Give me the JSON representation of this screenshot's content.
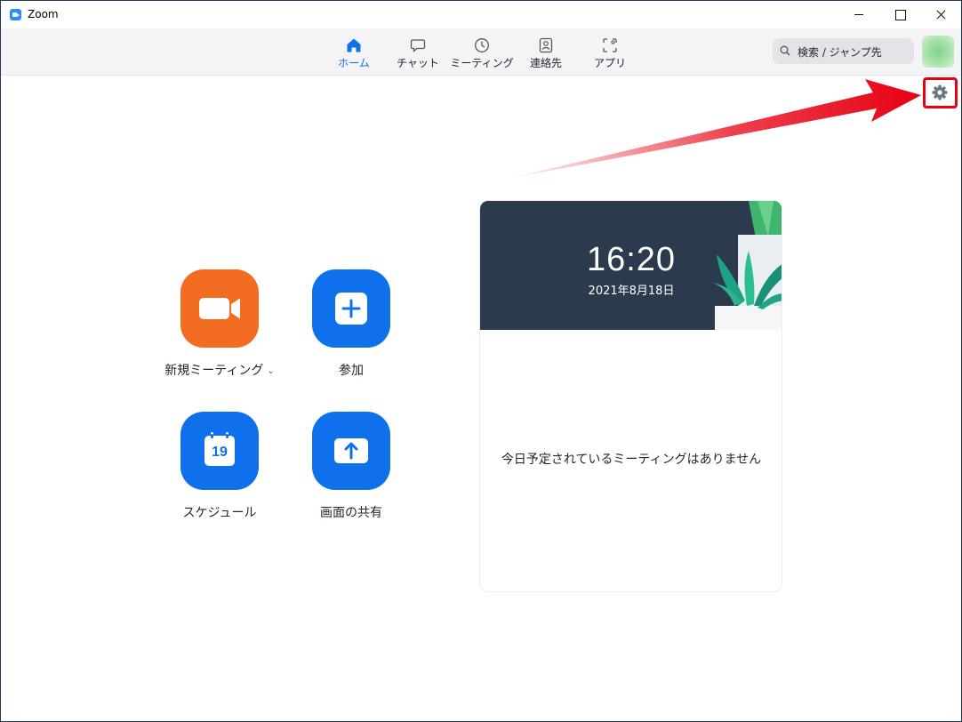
{
  "window": {
    "title": "Zoom"
  },
  "nav": {
    "tabs": [
      {
        "label": "ホーム",
        "icon": "home-icon",
        "active": true
      },
      {
        "label": "チャット",
        "icon": "chat-icon",
        "active": false
      },
      {
        "label": "ミーティング",
        "icon": "clock-icon",
        "active": false
      },
      {
        "label": "連絡先",
        "icon": "contacts-icon",
        "active": false
      },
      {
        "label": "アプリ",
        "icon": "apps-icon",
        "active": false
      }
    ],
    "search_placeholder": "検索 / ジャンプ先"
  },
  "actions": {
    "new_meeting": "新規ミーティング",
    "join": "参加",
    "schedule": "スケジュール",
    "share_screen": "画面の共有",
    "schedule_day": "19"
  },
  "calendar": {
    "time": "16:20",
    "date": "2021年8月18日",
    "empty_message": "今日予定されているミーティングはありません"
  },
  "colors": {
    "accent": "#0e72ed",
    "new_meeting": "#f26d21",
    "tile_blue": "#0e71eb",
    "annotation": "#e60012"
  }
}
